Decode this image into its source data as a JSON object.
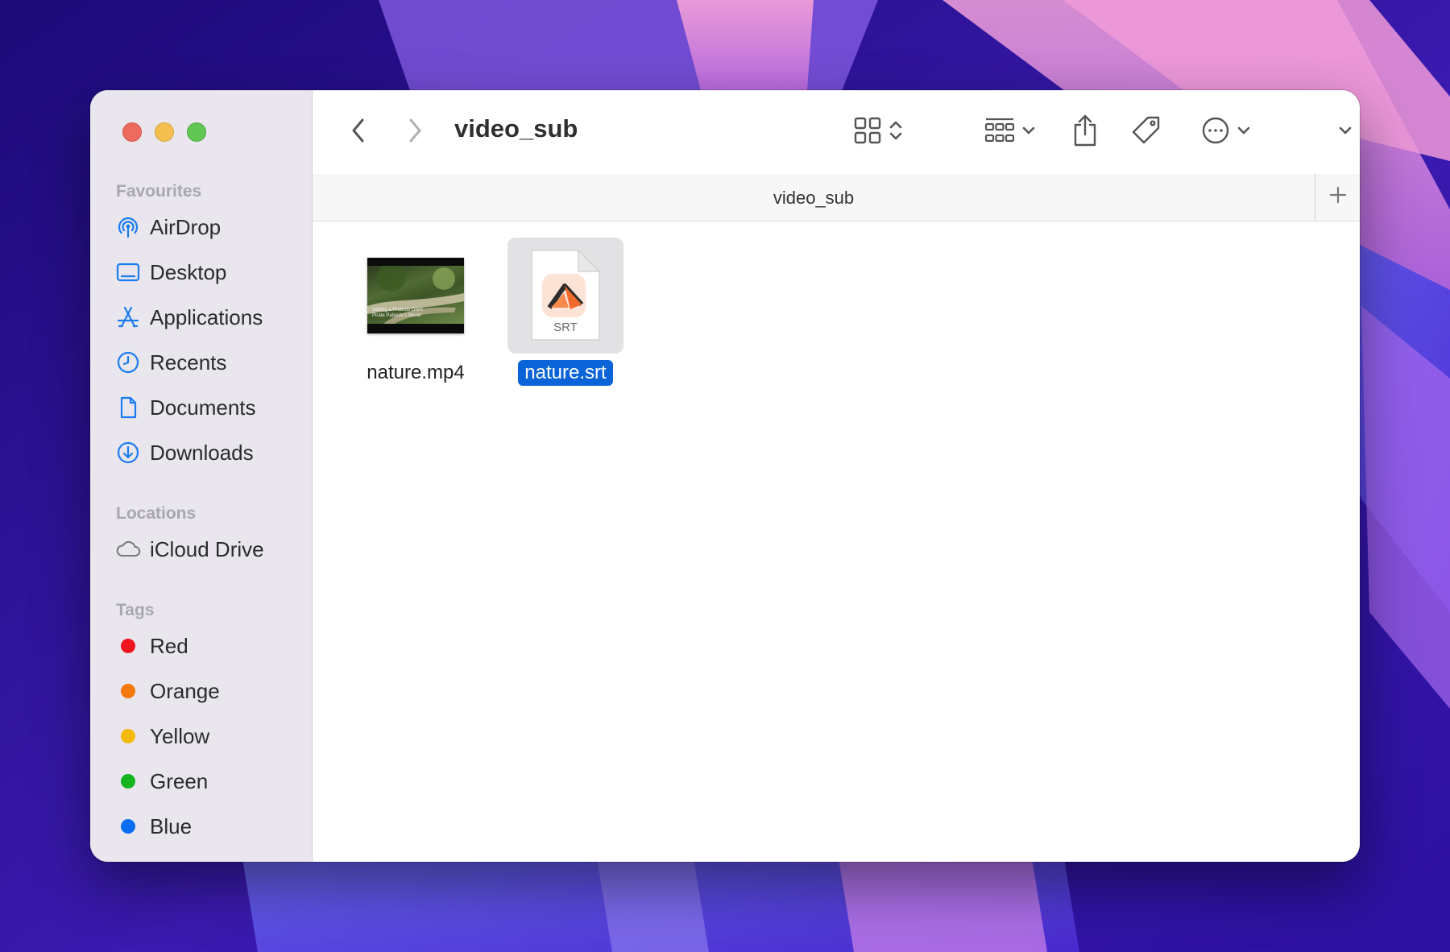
{
  "window": {
    "title": "video_sub",
    "tab_title": "video_sub"
  },
  "sidebar": {
    "favourites_title": "Favourites",
    "favourites": [
      {
        "label": "AirDrop",
        "icon": "airdrop-icon"
      },
      {
        "label": "Desktop",
        "icon": "desktop-icon"
      },
      {
        "label": "Applications",
        "icon": "applications-icon"
      },
      {
        "label": "Recents",
        "icon": "clock-icon"
      },
      {
        "label": "Documents",
        "icon": "document-icon"
      },
      {
        "label": "Downloads",
        "icon": "download-icon"
      }
    ],
    "locations_title": "Locations",
    "locations": [
      {
        "label": "iCloud Drive",
        "icon": "cloud-icon"
      }
    ],
    "tags_title": "Tags",
    "tags": [
      {
        "label": "Red",
        "color": "#f0141e"
      },
      {
        "label": "Orange",
        "color": "#f5780a"
      },
      {
        "label": "Yellow",
        "color": "#f5b90a"
      },
      {
        "label": "Green",
        "color": "#14b41e"
      },
      {
        "label": "Blue",
        "color": "#0a6ef0"
      }
    ]
  },
  "files": [
    {
      "name": "nature.mp4",
      "kind": "video",
      "caption": "Setting a Protests Don't Pirate Patients's Blend",
      "selected": false
    },
    {
      "name": "nature.srt",
      "kind": "subtitle",
      "badge": "SRT",
      "selected": true
    }
  ],
  "colors": {
    "accent": "#0a64d8",
    "sidebar_icon": "#1a7cf0"
  }
}
